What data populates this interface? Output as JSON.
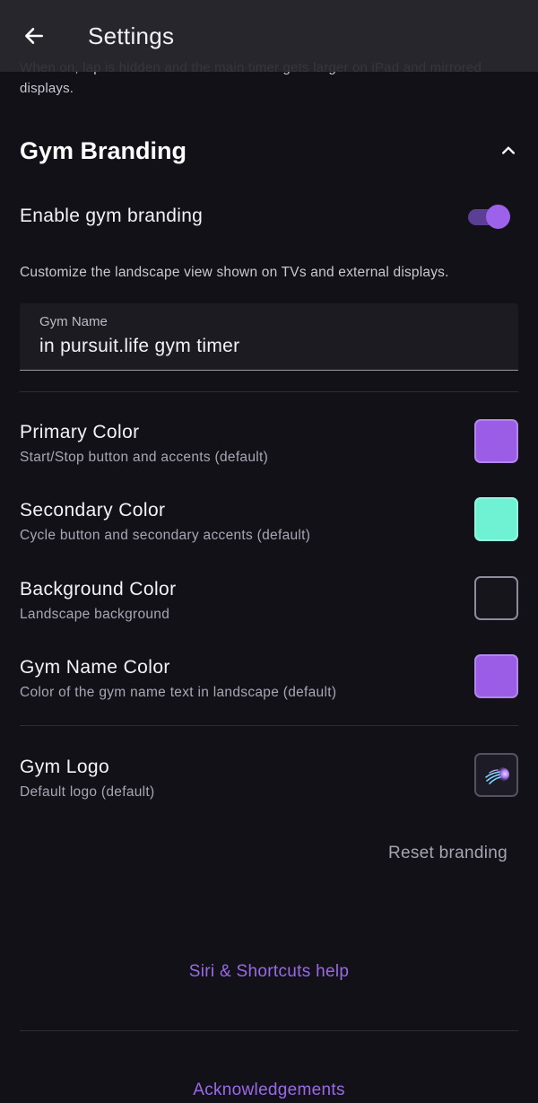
{
  "header": {
    "title": "Settings",
    "clipped_description": "When on, lap is hidden and the main timer gets larger on iPad and mirrored displays."
  },
  "section": {
    "title": "Gym Branding",
    "expanded": true
  },
  "toggle": {
    "label": "Enable gym branding",
    "on": true
  },
  "helper_text": "Customize the landscape view shown on TVs and external displays.",
  "gym_name_field": {
    "label": "Gym Name",
    "value": "in pursuit.life gym timer"
  },
  "colors": [
    {
      "title": "Primary Color",
      "subtitle": "Start/Stop button and accents (default)",
      "color": "#9b5de5"
    },
    {
      "title": "Secondary Color",
      "subtitle": "Cycle button and secondary accents (default)",
      "color": "#6ef2d3"
    },
    {
      "title": "Background Color",
      "subtitle": "Landscape background",
      "color": "#16151c"
    },
    {
      "title": "Gym Name Color",
      "subtitle": "Color of the gym name text in landscape (default)",
      "color": "#9b5de5"
    }
  ],
  "logo": {
    "title": "Gym Logo",
    "subtitle": "Default logo (default)",
    "icon": "jellyfish-logo-icon"
  },
  "reset_label": "Reset branding",
  "links": {
    "siri": "Siri & Shortcuts help",
    "acknowledgements": "Acknowledgements"
  },
  "theme": {
    "accent": "#9b5de5",
    "link": "#9a6ae6",
    "background": "#121118"
  }
}
